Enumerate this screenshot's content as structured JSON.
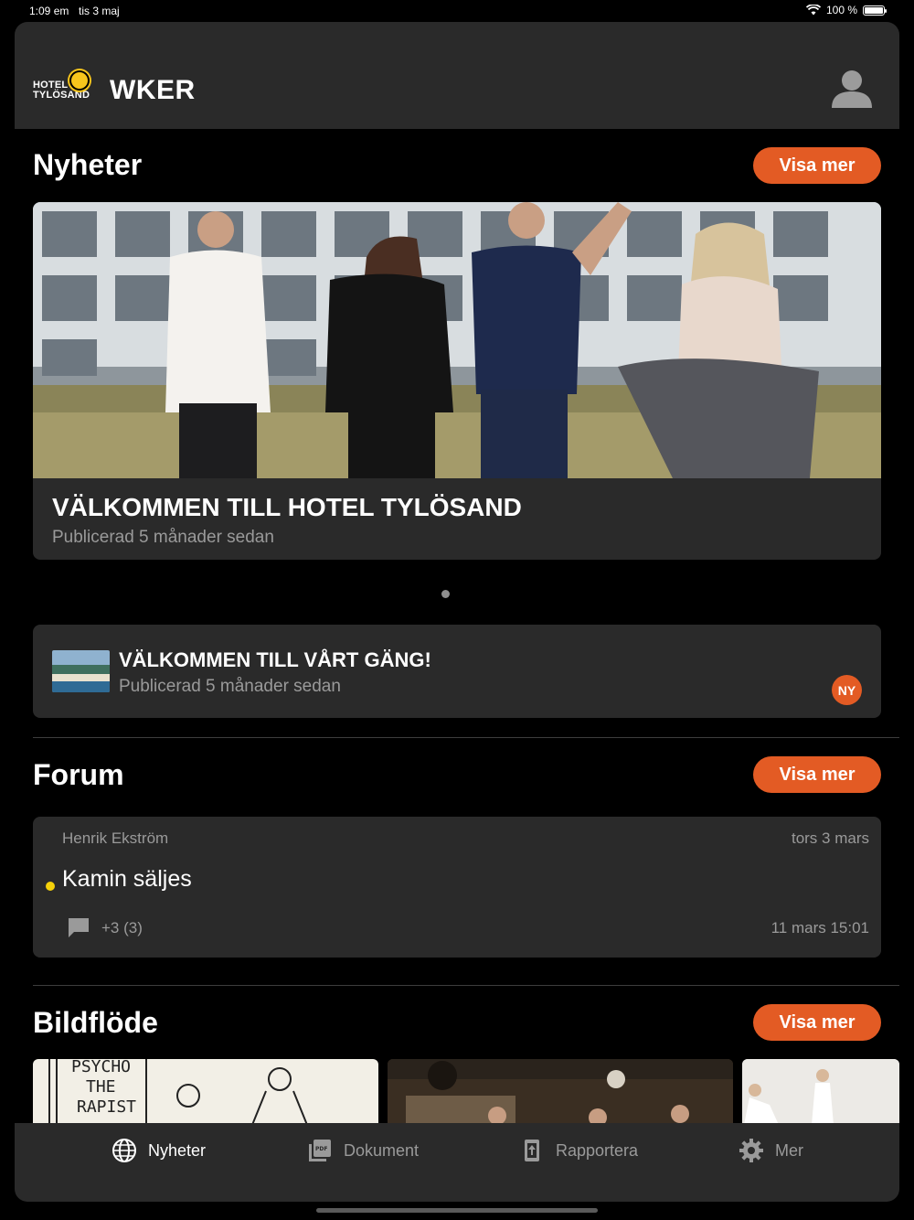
{
  "status_bar": {
    "time": "1:09 em",
    "date": "tis 3 maj",
    "battery": "100 %"
  },
  "header": {
    "logo_line1": "HOTEL",
    "logo_line2": "TYLÖSAND",
    "brand": "WKER"
  },
  "news": {
    "title": "Nyheter",
    "more_label": "Visa mer",
    "featured": {
      "title": "VÄLKOMMEN TILL HOTEL TYLÖSAND",
      "published": "Publicerad 5 månader sedan"
    },
    "item": {
      "title": "VÄLKOMMEN TILL VÅRT GÄNG!",
      "published": "Publicerad 5 månader sedan",
      "badge": "NY"
    }
  },
  "forum": {
    "title": "Forum",
    "more_label": "Visa mer",
    "post": {
      "author": "Henrik Ekström",
      "date": "tors 3 mars",
      "title": "Kamin säljes",
      "comments": "+3  (3)",
      "last_activity": "11 mars 15:01"
    }
  },
  "gallery": {
    "title": "Bildflöde",
    "more_label": "Visa mer",
    "sketch_text": [
      "PSYCHO",
      "THE",
      "RAPIST"
    ]
  },
  "tabs": [
    {
      "label": "Nyheter",
      "icon": "globe-icon",
      "active": true
    },
    {
      "label": "Dokument",
      "icon": "pdf-icon",
      "active": false
    },
    {
      "label": "Rapportera",
      "icon": "upload-icon",
      "active": false
    },
    {
      "label": "Mer",
      "icon": "gear-icon",
      "active": false
    }
  ],
  "colors": {
    "accent": "#e35b24",
    "card": "#2a2a2a",
    "background": "#000000",
    "unread_dot": "#f5d10a"
  }
}
